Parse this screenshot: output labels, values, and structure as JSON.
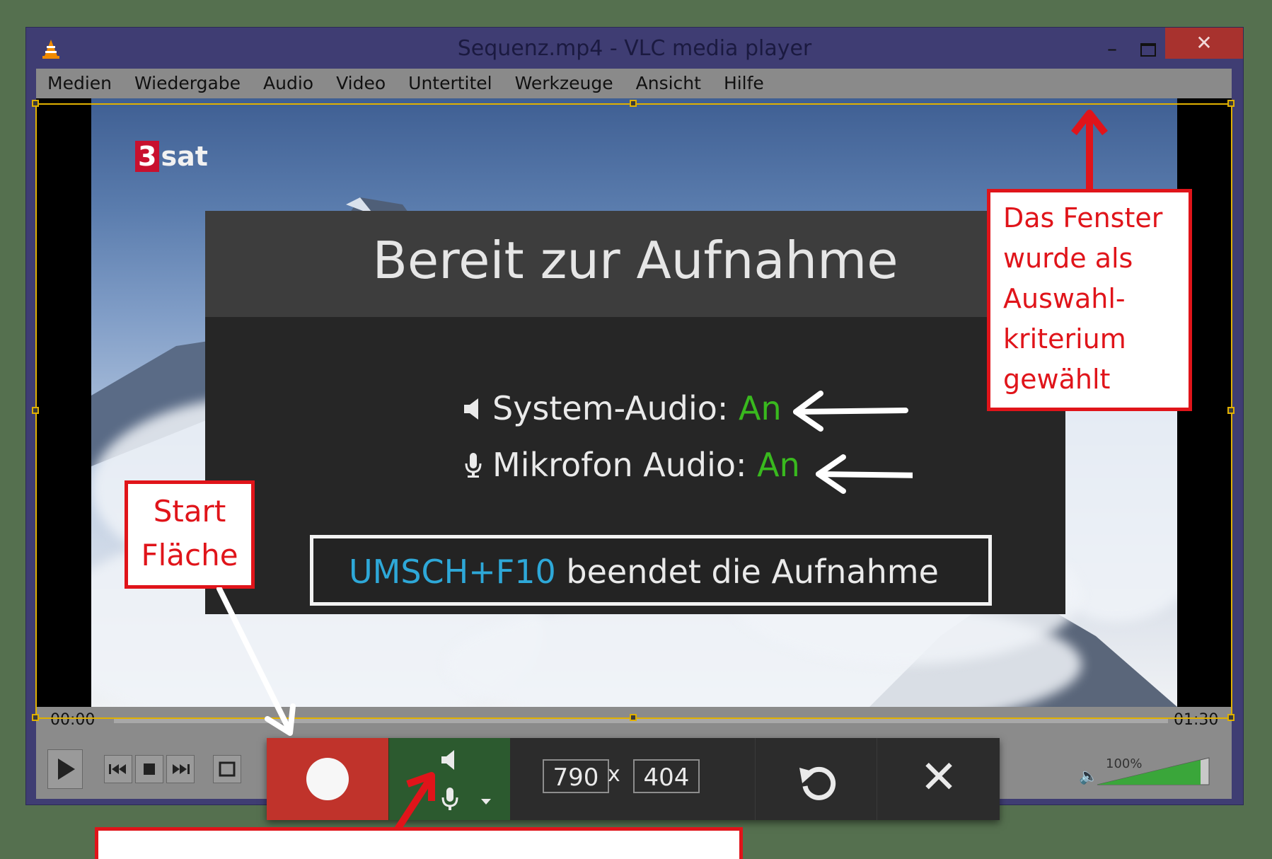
{
  "window": {
    "title": "Sequenz.mp4 - VLC media player",
    "minimize_glyph": "–",
    "close_glyph": "✕"
  },
  "menu": {
    "items": [
      "Medien",
      "Wiedergabe",
      "Audio",
      "Video",
      "Untertitel",
      "Werkzeuge",
      "Ansicht",
      "Hilfe"
    ]
  },
  "video": {
    "channel_logo_num": "3",
    "channel_logo_text": "sat"
  },
  "overlay": {
    "title": "Bereit zur Aufnahme",
    "system_audio_label": "System-Audio:",
    "system_audio_value": "An",
    "mic_audio_label": "Mikrofon Audio:",
    "mic_audio_value": "An",
    "shortcut_key": "UMSCH+F10",
    "shortcut_text": " beendet die Aufnahme",
    "status_color": "#39b91e",
    "key_color": "#2ea8d8"
  },
  "player": {
    "time_elapsed": "00:00",
    "time_total": "01:30",
    "volume_label": "100%",
    "volume_level": 1.0
  },
  "recorder": {
    "width": "790",
    "height": "404",
    "separator": "x",
    "close_glyph": "✕"
  },
  "callouts": {
    "window_note": [
      "Das Fenster",
      "wurde als",
      "Auswahl-",
      "kriterium",
      "gewählt"
    ],
    "start_note": [
      "Start",
      "Fläche"
    ]
  },
  "colors": {
    "accent_red": "#e0141a",
    "record_red": "#c0332b",
    "audio_green": "#2c5a2f",
    "selection_yellow": "#e0b000"
  }
}
